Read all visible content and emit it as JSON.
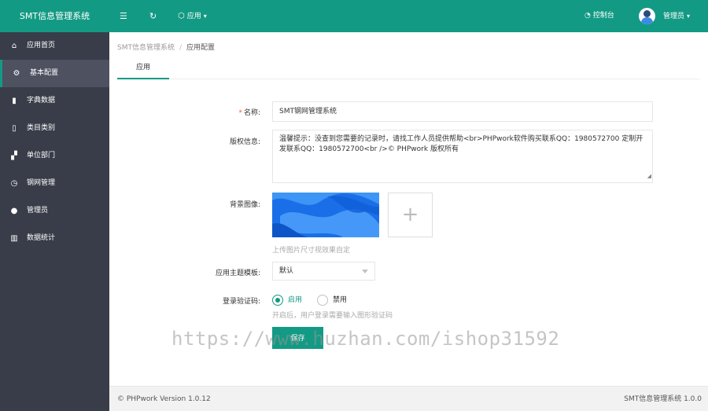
{
  "header": {
    "logo": "SMT信息管理系统",
    "app_menu_label": "应用",
    "console_label": "控制台",
    "admin_label": "管理员",
    "icons": [
      "menu-toggle-icon",
      "refresh-icon",
      "cube-icon",
      "dashboard-icon",
      "avatar"
    ]
  },
  "sidebar": {
    "items": [
      {
        "label": "应用首页",
        "icon": "home-icon"
      },
      {
        "label": "基本配置",
        "icon": "gear-icon",
        "active": true
      },
      {
        "label": "字典数据",
        "icon": "book-icon"
      },
      {
        "label": "类目类别",
        "icon": "file-icon"
      },
      {
        "label": "单位部门",
        "icon": "org-icon"
      },
      {
        "label": "钢网管理",
        "icon": "clock-icon"
      },
      {
        "label": "管理员",
        "icon": "user-icon"
      },
      {
        "label": "数据统计",
        "icon": "chart-icon"
      }
    ]
  },
  "breadcrumb": {
    "root": "SMT信息管理系统",
    "separator": "/",
    "current": "应用配置"
  },
  "tabs": [
    {
      "label": "应用",
      "active": true
    }
  ],
  "form": {
    "name_label": "名称:",
    "name_required": "*",
    "name_value": "SMT钢网管理系统",
    "copyright_label": "版权信息:",
    "copyright_value": "温馨提示：没查到您需要的记录时，请找工作人员提供帮助<br>PHPwork软件购买联系QQ：1980572700 定制开发联系QQ：1980572700<br />© PHPwork 版权所有",
    "bg_label": "背景图像:",
    "bg_hint": "上传图片尺寸视效果自定",
    "upload_symbol": "+",
    "theme_label": "应用主题模板:",
    "theme_value": "默认",
    "captcha_label": "登录验证码:",
    "captcha_on": "启用",
    "captcha_off": "禁用",
    "captcha_selected": "启用",
    "captcha_hint": "开启后，用户登录需要输入图形验证码",
    "save_label": "保存"
  },
  "watermark": "https://www.huzhan.com/ishop31592",
  "footer": {
    "left": "© PHPwork Version 1.0.12",
    "right": "SMT信息管理系统 1.0.0"
  },
  "colors": {
    "primary": "#139a84",
    "sidebar_bg": "#393d49",
    "sidebar_active": "#4d5160"
  }
}
